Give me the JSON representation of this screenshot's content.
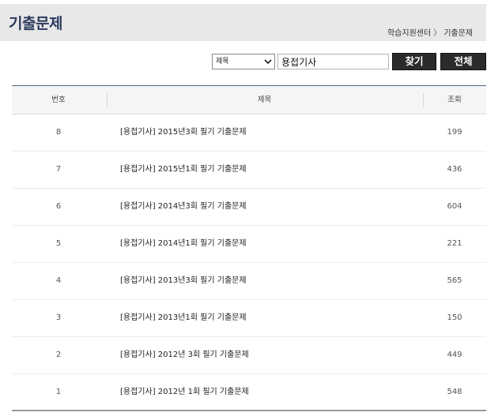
{
  "header": {
    "title": "기출문제",
    "breadcrumb": {
      "home": "학습지원센터",
      "separator": "〉",
      "current": "기출문제"
    }
  },
  "search": {
    "select_value": "제목",
    "input_value": "용접기사",
    "find_label": "찾기",
    "all_label": "전체"
  },
  "table": {
    "headers": {
      "no": "번호",
      "title": "제목",
      "views": "조회"
    },
    "rows": [
      {
        "no": "8",
        "title": "[용접기사] 2015년3회 필기 기출문제",
        "views": "199"
      },
      {
        "no": "7",
        "title": "[용접기사] 2015년1회 필기 기출문제",
        "views": "436"
      },
      {
        "no": "6",
        "title": "[용접기사] 2014년3회 필기 기출문제",
        "views": "604"
      },
      {
        "no": "5",
        "title": "[용접기사] 2014년1회 필기 기출문제",
        "views": "221"
      },
      {
        "no": "4",
        "title": "[용접기사] 2013년3회 필기 기출문제",
        "views": "565"
      },
      {
        "no": "3",
        "title": "[용접기사] 2013년1회 필기 기출문제",
        "views": "150"
      },
      {
        "no": "2",
        "title": "[용접기사] 2012년 3회 필기 기출문제",
        "views": "449"
      },
      {
        "no": "1",
        "title": "[용접기사] 2012년 1회 필기 기출문제",
        "views": "548"
      }
    ]
  },
  "icons": {
    "select_arrow": "chevron-down-icon"
  },
  "colors": {
    "title": "#2c3a5e",
    "button_bg": "#2b2b2b",
    "header_bg": "#e8e8e8"
  }
}
